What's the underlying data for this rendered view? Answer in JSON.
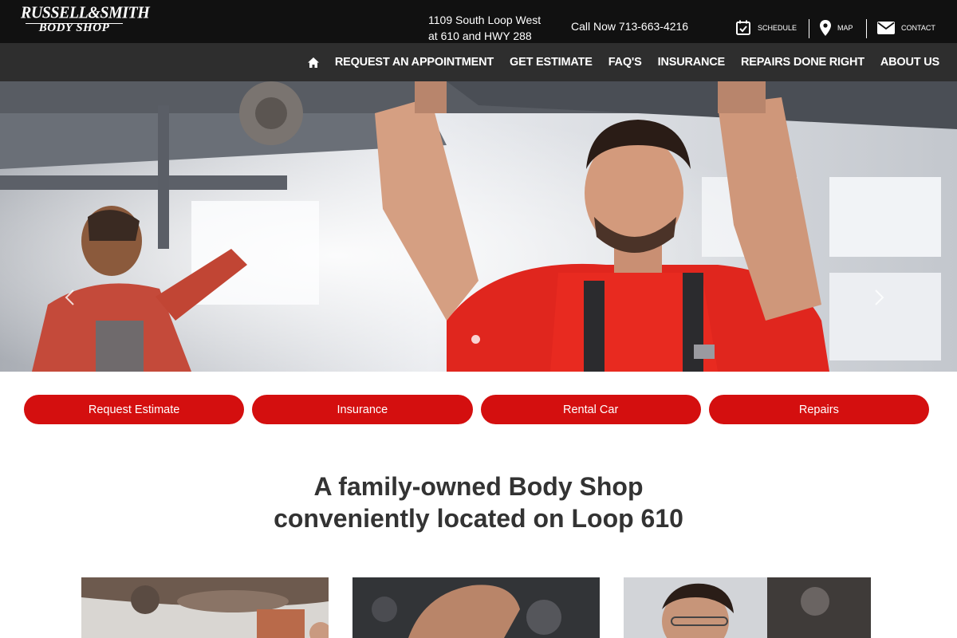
{
  "header": {
    "logo_line1": "RUSSELL&SMITH",
    "logo_line2": "BODY SHOP",
    "address_line1": "1109 South Loop West",
    "address_line2": "at 610 and HWY 288",
    "call_now": "Call Now 713-663-4216",
    "utility_links": [
      {
        "label": "SCHEDULE",
        "icon": "calendar-check-icon"
      },
      {
        "label": "MAP",
        "icon": "map-pin-icon"
      },
      {
        "label": "CONTACT",
        "icon": "envelope-icon"
      }
    ]
  },
  "nav": {
    "home_icon": "home-icon",
    "items": [
      {
        "label": "REQUEST AN APPOINTMENT"
      },
      {
        "label": "GET ESTIMATE"
      },
      {
        "label": "FAQ'S"
      },
      {
        "label": "INSURANCE"
      },
      {
        "label": "REPAIRS DONE RIGHT"
      },
      {
        "label": "ABOUT US"
      }
    ]
  },
  "hero": {
    "prev_icon": "chevron-left-icon",
    "next_icon": "chevron-right-icon",
    "slide_count": 1
  },
  "cta_buttons": [
    {
      "label": "Request Estimate"
    },
    {
      "label": "Insurance"
    },
    {
      "label": "Rental Car"
    },
    {
      "label": "Repairs"
    }
  ],
  "headline": {
    "line1": "A family-owned Body Shop",
    "line2": "conveniently located on Loop 610"
  },
  "colors": {
    "topbar": "#111111",
    "navbar": "#2e2e2e",
    "accent_red": "#d40f0f",
    "headline_text": "#333333"
  }
}
